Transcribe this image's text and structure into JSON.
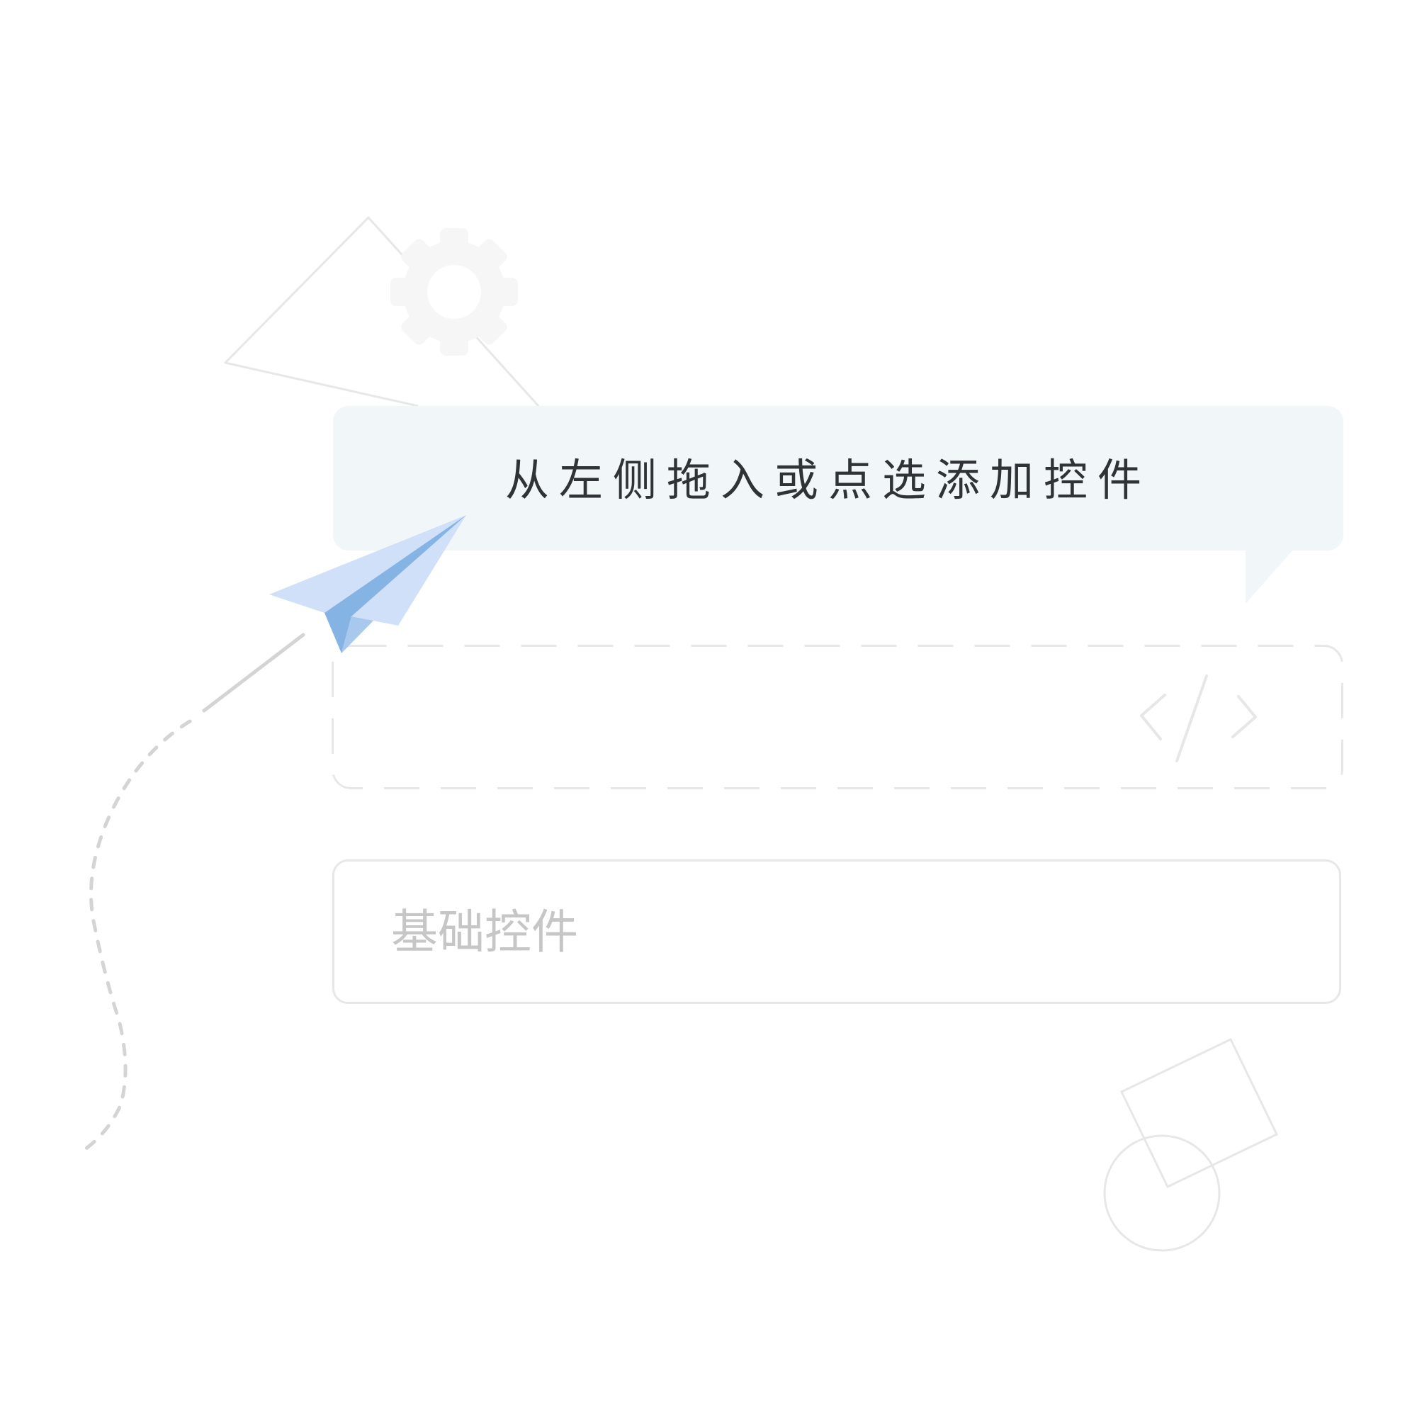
{
  "hint": {
    "message": "从左侧拖入或点选添加控件"
  },
  "palette": {
    "basic_controls_label": "基础控件"
  },
  "colors": {
    "bubble_bg": "#f1f6f9",
    "hint_text": "#2f3337",
    "placeholder_text": "#c6c6c6",
    "outline_gray": "#e7e7e7",
    "plane_light_blue": "#cfe0f8",
    "plane_mid_blue": "#85b4e4",
    "gear_gray": "#f6f6f6",
    "trail_gray": "#d4d4d4"
  },
  "icons": {
    "plane": "paper-plane-icon",
    "gear": "gear-icon",
    "code": "code-brackets-icon",
    "rotated_square": "rotated-square-icon",
    "circle": "circle-outline-icon",
    "triangle": "triangle-outline-icon"
  }
}
